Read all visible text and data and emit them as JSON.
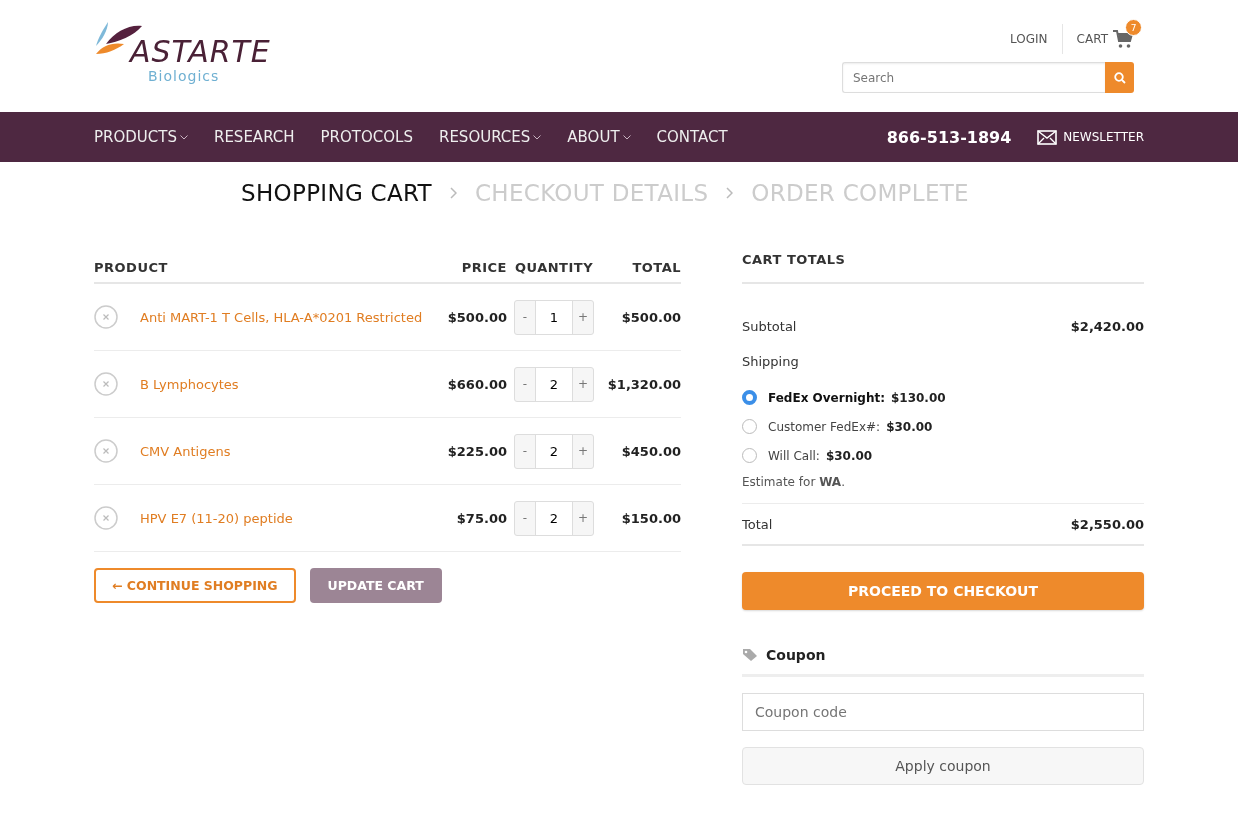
{
  "header": {
    "logo": {
      "name": "ASTARTE",
      "subtitle": "Biologics"
    },
    "login": "LOGIN",
    "cart": {
      "label": "CART",
      "count": "7"
    },
    "search": {
      "placeholder": "Search"
    }
  },
  "nav": {
    "items": [
      {
        "label": "PRODUCTS",
        "has_dropdown": true
      },
      {
        "label": "RESEARCH",
        "has_dropdown": false
      },
      {
        "label": "PROTOCOLS",
        "has_dropdown": false
      },
      {
        "label": "RESOURCES",
        "has_dropdown": true
      },
      {
        "label": "ABOUT",
        "has_dropdown": true
      },
      {
        "label": "CONTACT",
        "has_dropdown": false
      }
    ],
    "phone": "866-513-1894",
    "newsletter": "NEWSLETTER"
  },
  "steps": [
    {
      "label": "SHOPPING CART",
      "selected": true
    },
    {
      "label": "CHECKOUT DETAILS",
      "selected": false
    },
    {
      "label": "ORDER COMPLETE",
      "selected": false
    }
  ],
  "cart_table": {
    "columns": [
      "PRODUCT",
      "PRICE",
      "QUANTITY",
      "TOTAL"
    ],
    "rows": [
      {
        "product": "Anti MART-1 T Cells, HLA-A*0201 Restricted",
        "price": "$500.00",
        "quantity": "1",
        "total": "$500.00"
      },
      {
        "product": "B Lymphocytes",
        "price": "$660.00",
        "quantity": "2",
        "total": "$1,320.00"
      },
      {
        "product": "CMV Antigens",
        "price": "$225.00",
        "quantity": "2",
        "total": "$450.00"
      },
      {
        "product": "HPV E7 (11-20) peptide",
        "price": "$75.00",
        "quantity": "2",
        "total": "$150.00"
      }
    ],
    "minus": "-",
    "plus": "+"
  },
  "actions": {
    "continue": "← CONTINUE SHOPPING",
    "update": "UPDATE CART"
  },
  "totals": {
    "title": "CART TOTALS",
    "subtotal_label": "Subtotal",
    "subtotal": "$2,420.00",
    "shipping_label": "Shipping",
    "shipping_options": [
      {
        "label": "FedEx Overnight:",
        "price": "$130.00",
        "selected": true
      },
      {
        "label": "Customer FedEx#:",
        "price": "$30.00",
        "selected": false
      },
      {
        "label": "Will Call:",
        "price": "$30.00",
        "selected": false
      }
    ],
    "estimate": "Estimate for **WA**.",
    "total_label": "Total",
    "total": "$2,550.00",
    "checkout": "PROCEED TO CHECKOUT"
  },
  "coupon": {
    "title": "Coupon",
    "placeholder": "Coupon code",
    "apply": "Apply coupon"
  }
}
